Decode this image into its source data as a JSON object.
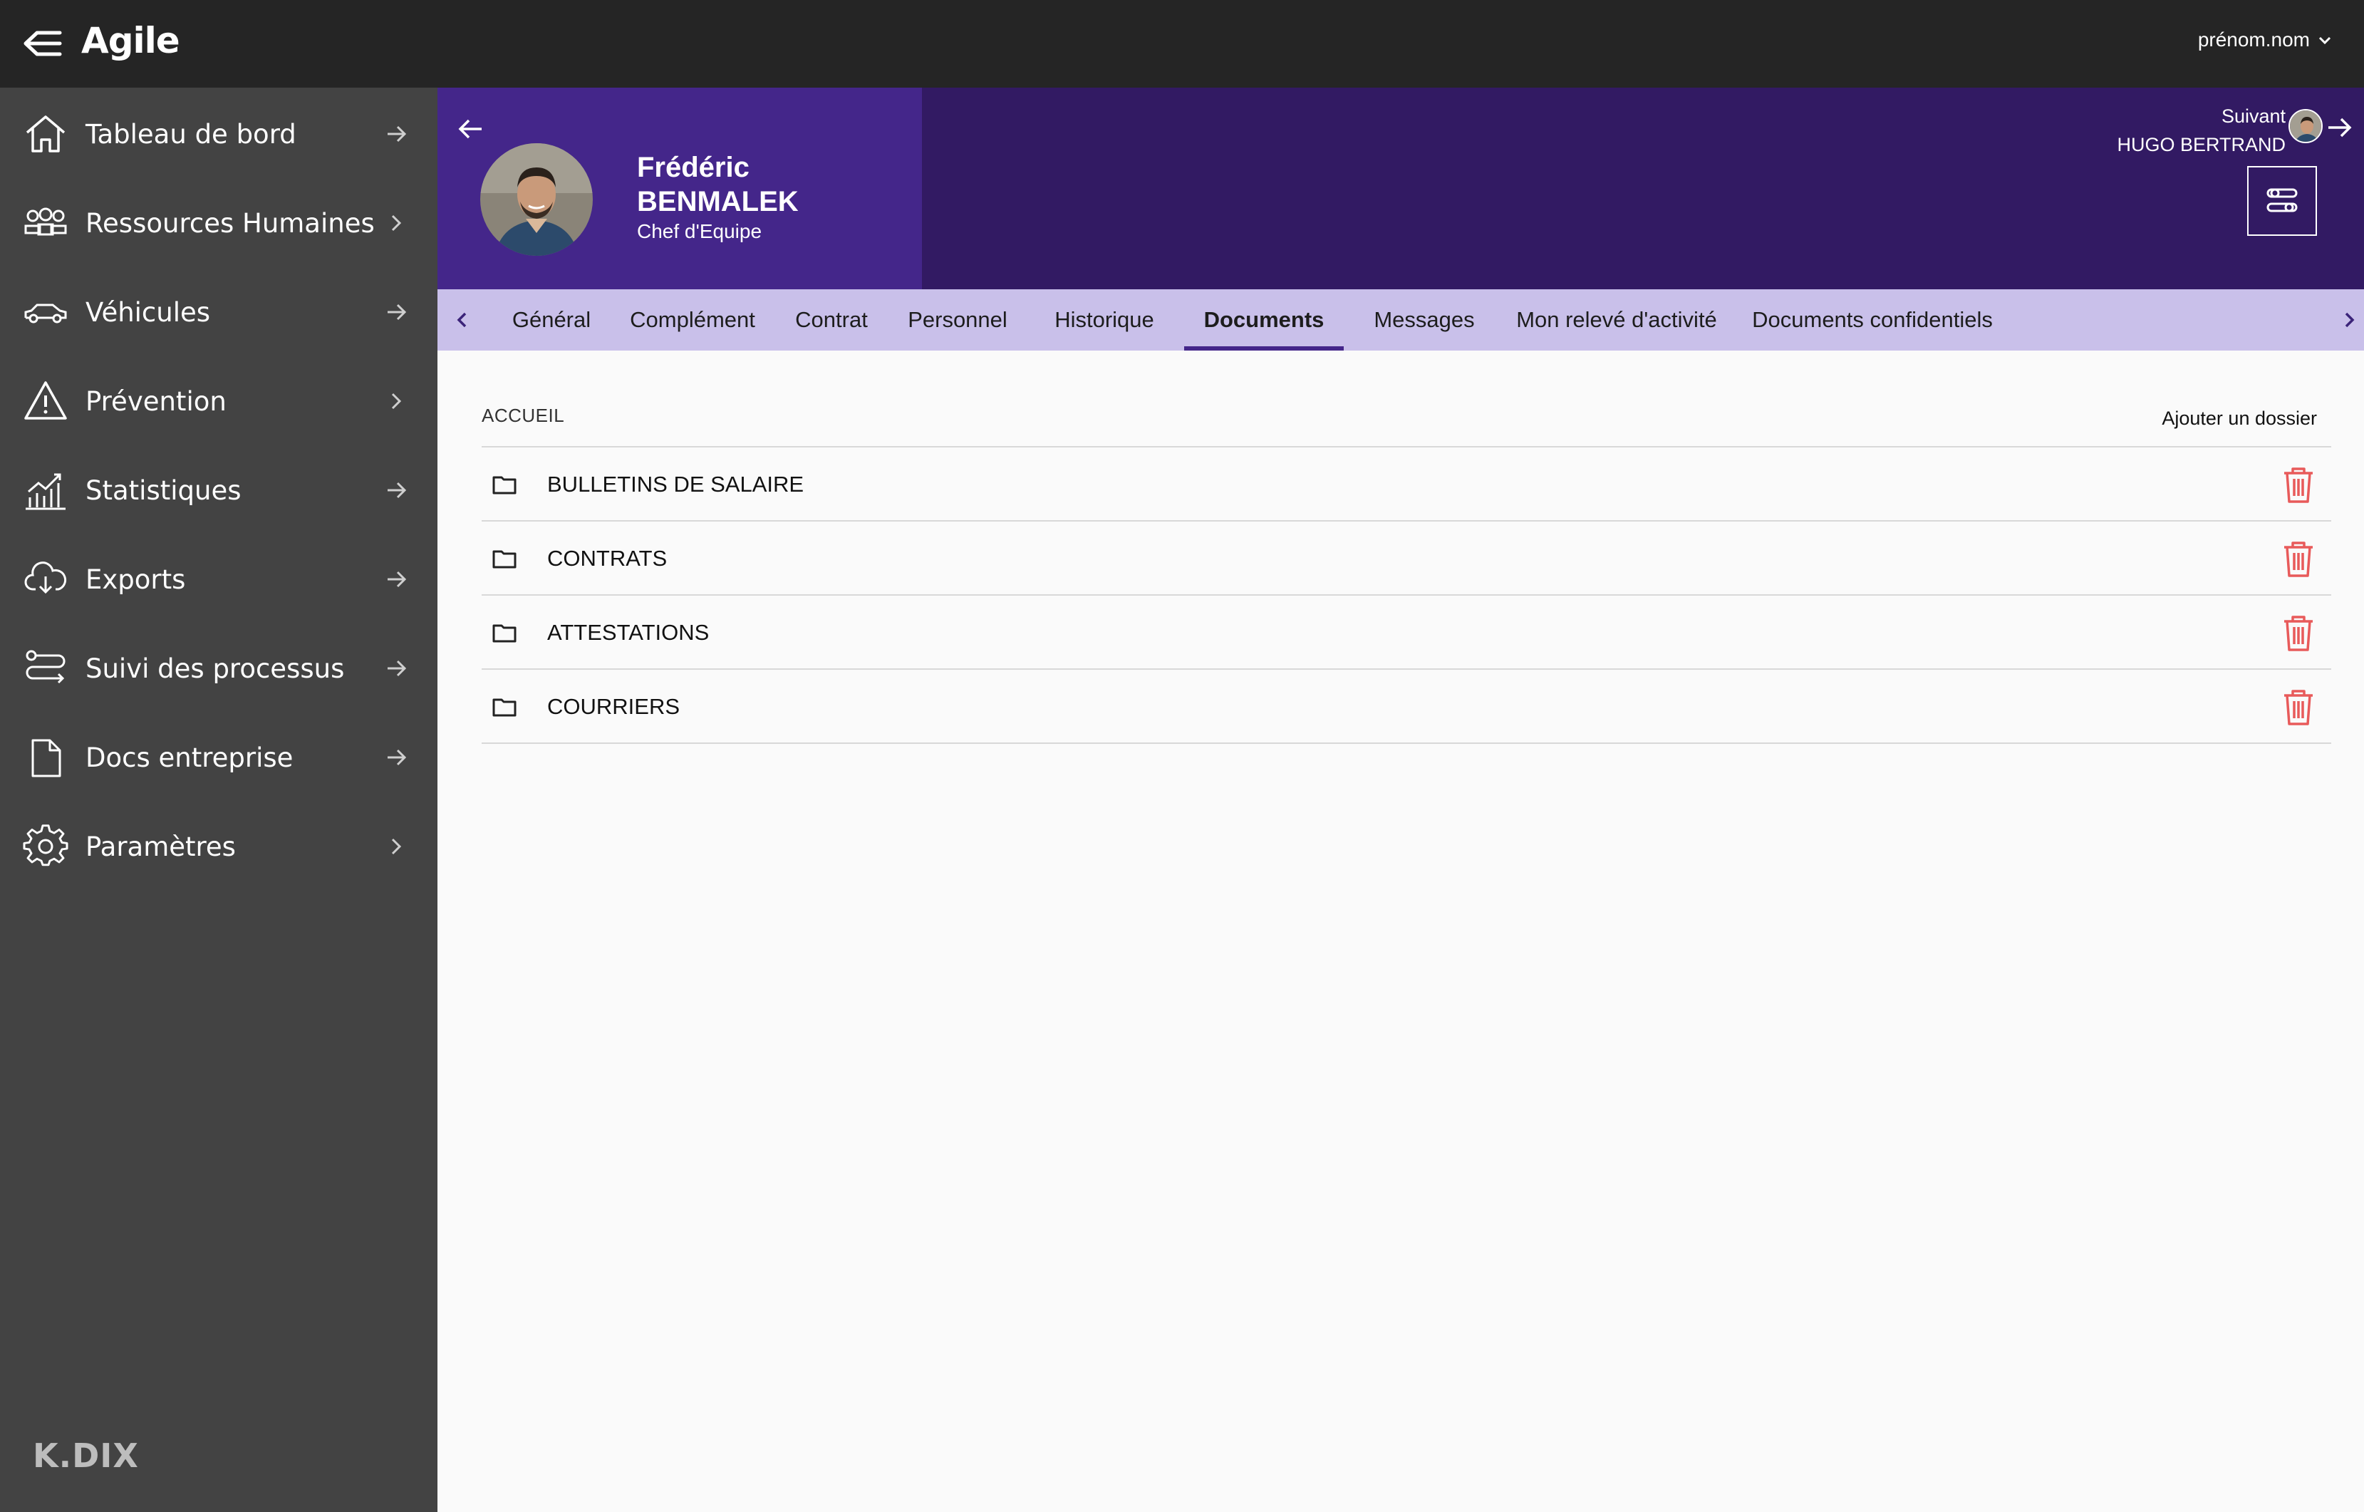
{
  "app": {
    "title": "Agile",
    "user_menu_label": "prénom.nom"
  },
  "sidebar": {
    "items": [
      {
        "label": "Tableau de bord",
        "icon": "home-icon"
      },
      {
        "label": "Ressources Humaines",
        "icon": "people-icon"
      },
      {
        "label": "Véhicules",
        "icon": "car-icon"
      },
      {
        "label": "Prévention",
        "icon": "warning-icon"
      },
      {
        "label": "Statistiques",
        "icon": "chart-icon"
      },
      {
        "label": "Exports",
        "icon": "cloud-download-icon"
      },
      {
        "label": "Suivi des processus",
        "icon": "process-icon"
      },
      {
        "label": "Docs entreprise",
        "icon": "document-icon"
      },
      {
        "label": "Paramètres",
        "icon": "gear-icon"
      }
    ],
    "footer_logo": "K.DIX"
  },
  "profile": {
    "first_name": "Frédéric",
    "last_name": "BENMALEK",
    "role": "Chef d'Equipe",
    "next_label": "Suivant",
    "next_name": "HUGO BERTRAND"
  },
  "tabs": [
    {
      "label": "Général"
    },
    {
      "label": "Complément"
    },
    {
      "label": "Contrat"
    },
    {
      "label": "Personnel"
    },
    {
      "label": "Historique"
    },
    {
      "label": "Documents"
    },
    {
      "label": "Messages"
    },
    {
      "label": "Mon relevé d'activité"
    },
    {
      "label": "Documents confidentiels"
    }
  ],
  "active_tab": "Documents",
  "documents": {
    "breadcrumb": "ACCUEIL",
    "add_folder_label": "Ajouter un dossier",
    "folders": [
      {
        "name": "BULLETINS DE SALAIRE"
      },
      {
        "name": "CONTRATS"
      },
      {
        "name": "ATTESTATIONS"
      },
      {
        "name": "COURRIERS"
      }
    ]
  },
  "colors": {
    "topbar": "#252525",
    "sidebar": "#434343",
    "header_dark": "#321a63",
    "header_card": "#44268a",
    "tabbar": "#c9c0ea",
    "delete": "#e85a5a"
  }
}
